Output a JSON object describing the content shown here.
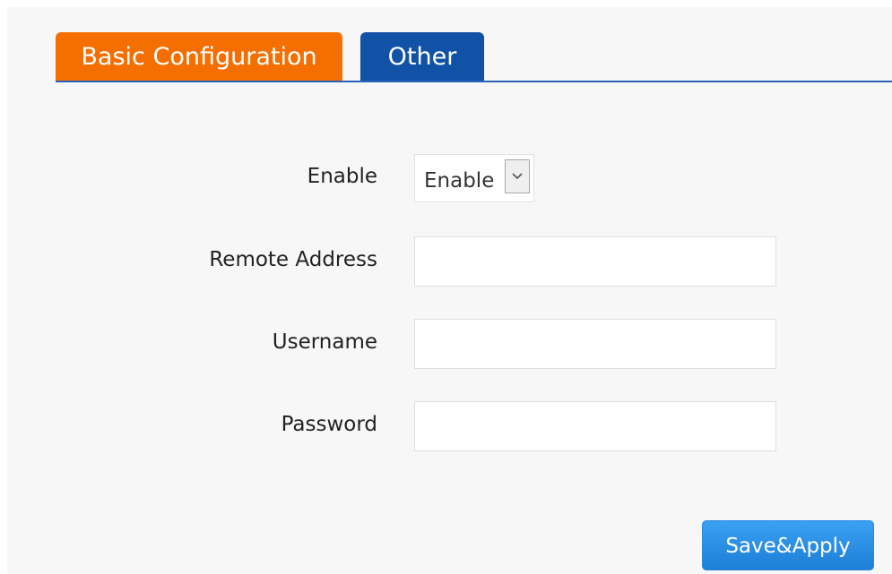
{
  "tabs": [
    {
      "label": "Basic Configuration",
      "active": true
    },
    {
      "label": "Other",
      "active": false
    }
  ],
  "form": {
    "enable": {
      "label": "Enable",
      "value": "Enable"
    },
    "remote_address": {
      "label": "Remote Address",
      "value": ""
    },
    "username": {
      "label": "Username",
      "value": ""
    },
    "password": {
      "label": "Password",
      "value": ""
    }
  },
  "actions": {
    "save_label": "Save&Apply"
  },
  "colors": {
    "tab_basic": "#f56f00",
    "tab_other": "#1252a6",
    "save_button": "#2a89df"
  },
  "icons": {
    "select_arrow": "chevron-down-icon"
  }
}
